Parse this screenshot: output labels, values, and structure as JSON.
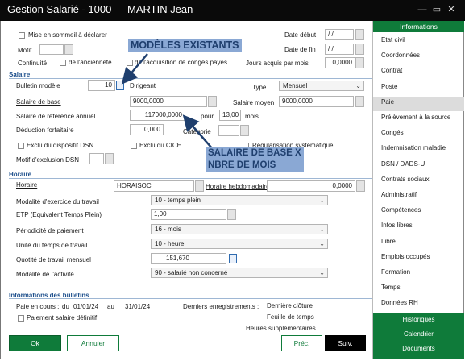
{
  "window": {
    "title": "Gestion Salarié - 1000",
    "employee": "MARTIN Jean"
  },
  "top": {
    "sommeil_label": "Mise en sommeil à déclarer",
    "motif_label": "Motif",
    "continuite_label": "Continuité",
    "anciennete_label": "de l'ancienneté",
    "acquisition_label": "de l'acquisition de congés payés",
    "date_debut_label": "Date début",
    "date_debut_value": "/ /",
    "date_fin_label": "Date de fin",
    "date_fin_value": "/ /",
    "jours_label": "Jours acquis par mois",
    "jours_value": "0,0000"
  },
  "salaire": {
    "section": "Salaire",
    "bulletin_label": "Bulletin modèle",
    "bulletin_value": "10",
    "bulletin_name": "Dirigeant",
    "type_label": "Type",
    "type_value": "Mensuel",
    "base_label": "Salaire de base",
    "base_value": "9000,0000",
    "moyen_label": "Salaire moyen",
    "moyen_value": "9000,0000",
    "reference_label": "Salaire de référence annuel",
    "reference_value": "117000,0000",
    "pour_label": "pour",
    "mois_value": "13,00",
    "mois_label": "mois",
    "deduction_label": "Déduction forfaitaire",
    "deduction_value": "0,000",
    "categorie_label": "Catégorie",
    "dsn_exclu_label": "Exclu du dispositif DSN",
    "cice_label": "Exclu du CICE",
    "regularisation_label": "Régularisation systématique",
    "motif_dsn_label": "Motif d'exclusion DSN"
  },
  "horaire": {
    "section": "Horaire",
    "horaire_label": "Horaire",
    "horaire_value": "HORAISOC",
    "hebdo_label": "Horaire hebdomadaire",
    "hebdo_value": "0,0000",
    "modalite_label": "Modalité d'exercice du travail",
    "modalite_value": "10 - temps plein",
    "etp_label": "ETP (Equivalent Temps Plein)",
    "etp_value": "1,00",
    "periodicite_label": "Périodicité de paiement",
    "periodicite_value": "16 - mois",
    "unite_label": "Unité du temps de travail",
    "unite_value": "10 - heure",
    "quotite_label": "Quotité de travail mensuel",
    "quotite_value": "151,670",
    "activite_label": "Modalité de l'activité",
    "activite_value": "90 - salarié non concerné"
  },
  "bulletins": {
    "section": "Informations des bulletins",
    "paie_label": "Paie en cours :",
    "du_label": "du",
    "du_value": "01/01/24",
    "au_label": "au",
    "au_value": "31/01/24",
    "derniers_label": "Derniers enregistrements :",
    "cloture_label": "Dernière clôture",
    "feuille_label": "Feuille de temps",
    "heures_label": "Heures supplémentaires",
    "definitif_label": "Paiement salaire définitif"
  },
  "annotations": {
    "modeles": "MODÈLES EXISTANTS",
    "salaire_line1": "SALAIRE DE BASE X",
    "salaire_line2": "NBRE DE MOIS"
  },
  "buttons": {
    "ok": "Ok",
    "annuler": "Annuler",
    "prec": "Préc.",
    "suiv": "Suiv."
  },
  "sidebar": {
    "header": "Informations",
    "items": [
      "Etat civil",
      "Coordonnées",
      "Contrat",
      "Poste",
      "Paie",
      "Prélèvement à la source",
      "Congés",
      "Indemnisation maladie",
      "DSN / DADS-U",
      "Contrats sociaux",
      "Administratif",
      "Compétences",
      "Infos libres",
      "Libre",
      "Emplois occupés",
      "Formation",
      "Temps",
      "Données RH"
    ],
    "selected": "Paie",
    "footer": [
      "Historiques",
      "Calendrier",
      "Documents"
    ]
  },
  "colors": {
    "accent_green": "#0f7b3a",
    "section_blue": "#1d4f8c",
    "annotation_bg": "#8aa8d4"
  }
}
